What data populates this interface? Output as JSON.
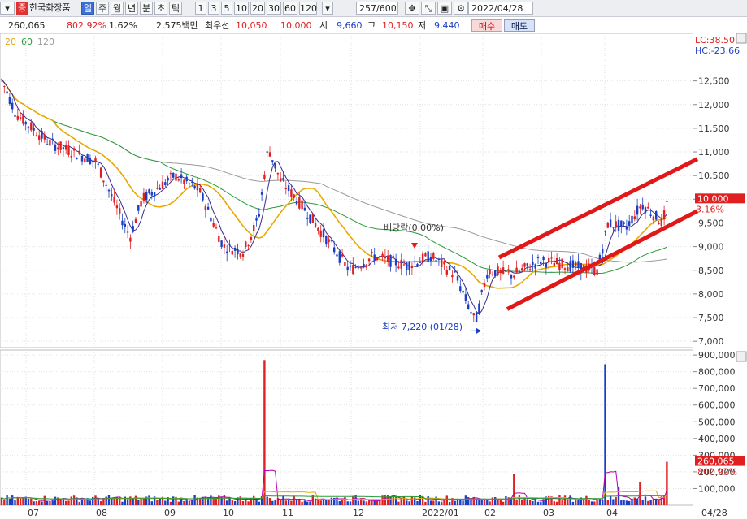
{
  "toolbar": {
    "stock_name": "한국화장품",
    "badge": "증",
    "periods": [
      "일",
      "주",
      "월",
      "년",
      "분",
      "초",
      "틱"
    ],
    "selected_period": "일",
    "intervals": [
      "1",
      "3",
      "5",
      "10",
      "20",
      "30",
      "60",
      "120"
    ],
    "count": "257/600",
    "date": "2022/04/28"
  },
  "infobar": {
    "volume": "260,065",
    "volume_ratio": "802.92%",
    "change_rate": "1.62%",
    "amount": "2,575백만",
    "best_ask_label": "최우선",
    "best_ask": "10,050",
    "best_bid": "10,000",
    "open_label": "시",
    "open": "9,660",
    "high_label": "고",
    "high": "10,150",
    "low_label": "저",
    "low": "9,440",
    "buy_label": "매수",
    "sell_label": "매도"
  },
  "colors": {
    "up": "#e02020",
    "down": "#1a3fc4",
    "ma5": "#3a2a8a",
    "ma20": "#e8a800",
    "ma60": "#2a9a3a",
    "ma120": "#9a9a9a",
    "trend": "#e01818"
  },
  "chart_data": [
    {
      "type": "candlestick",
      "ma_legend": [
        "20",
        "60",
        "120"
      ],
      "x_tick_labels": [
        "07",
        "08",
        "09",
        "10",
        "11",
        "12",
        "2022/01",
        "02",
        "03",
        "04"
      ],
      "last_date_label": "04/28",
      "y_ticks": [
        7000,
        7500,
        8000,
        8500,
        9000,
        9500,
        10000,
        10500,
        11000,
        11500,
        12000,
        12500
      ],
      "y_tick_labels": [
        "7,000",
        "7,500",
        "8,000",
        "8,500",
        "9,000",
        "9,500",
        "10,000",
        "10,500",
        "11,000",
        "11,500",
        "12,000",
        "12,500"
      ],
      "ylim": [
        6900,
        13300
      ],
      "last_price": 10000,
      "last_price_label": "10,000",
      "last_change_label": "3.16%",
      "lc_label": "LC:38.50",
      "hc_label": "HC:-23.66",
      "annotations": {
        "dividend": "배당락(0.00%)",
        "low": "최저 7,220 (01/28)"
      },
      "series_approx": [
        {
          "date": "07",
          "close": 12500
        },
        {
          "date": "07",
          "close": 11850
        },
        {
          "date": "08",
          "close": 11000
        },
        {
          "date": "08",
          "close": 9200
        },
        {
          "date": "09",
          "close": 10000
        },
        {
          "date": "09",
          "close": 10100
        },
        {
          "date": "10",
          "close": 9400
        },
        {
          "date": "10",
          "close": 9000
        },
        {
          "date": "10",
          "close": 11000
        },
        {
          "date": "11",
          "close": 10200
        },
        {
          "date": "11",
          "close": 9300
        },
        {
          "date": "12",
          "close": 8500
        },
        {
          "date": "12",
          "close": 8700
        },
        {
          "date": "2022/01",
          "close": 8800
        },
        {
          "date": "2022/01",
          "close": 7300
        },
        {
          "date": "02",
          "close": 8500
        },
        {
          "date": "03",
          "close": 8700
        },
        {
          "date": "03",
          "close": 8500
        },
        {
          "date": "04",
          "close": 9500
        },
        {
          "date": "04",
          "close": 10000
        }
      ]
    },
    {
      "type": "bar",
      "name": "volume",
      "y_ticks": [
        100000,
        200000,
        300000,
        400000,
        500000,
        600000,
        700000,
        800000,
        900000
      ],
      "y_tick_labels": [
        "100,000",
        "200,000",
        "300,000",
        "400,000",
        "500,000",
        "600,000",
        "700,000",
        "800,000",
        "900,000"
      ],
      "ylim": [
        0,
        920000
      ],
      "last_volume": 260065,
      "last_volume_label": "260,065",
      "last_ratio_label": "802.92%",
      "spikes": [
        {
          "date": "10",
          "value": 870000
        },
        {
          "date": "04",
          "value": 845000
        },
        {
          "date": "02",
          "value": 185000
        },
        {
          "date": "04",
          "value": 260065
        }
      ]
    }
  ]
}
